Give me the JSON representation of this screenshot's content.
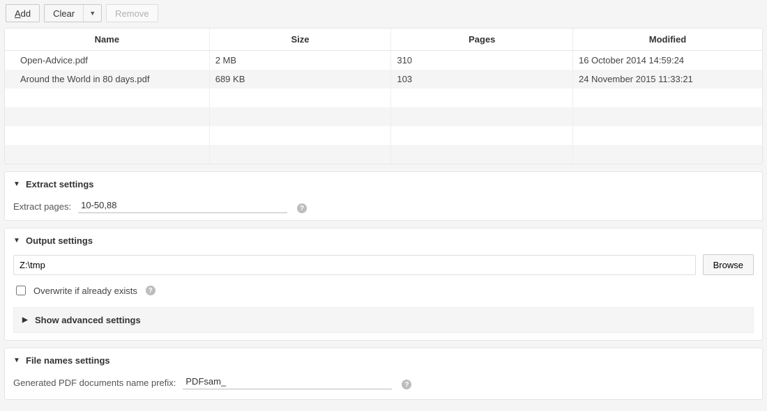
{
  "toolbar": {
    "add_label": "Add",
    "clear_label": "Clear",
    "remove_label": "Remove"
  },
  "table": {
    "columns": {
      "name": "Name",
      "size": "Size",
      "pages": "Pages",
      "modified": "Modified"
    },
    "rows": [
      {
        "name": "Open-Advice.pdf",
        "size": "2 MB",
        "pages": "310",
        "modified": "16 October 2014 14:59:24"
      },
      {
        "name": "Around the World in 80 days.pdf",
        "size": "689 KB",
        "pages": "103",
        "modified": "24 November 2015 11:33:21"
      }
    ]
  },
  "extract": {
    "title": "Extract settings",
    "pages_label": "Extract pages:",
    "pages_value": "10-50,88"
  },
  "output": {
    "title": "Output settings",
    "path": "Z:\\tmp",
    "browse_label": "Browse",
    "overwrite_label": "Overwrite if already exists",
    "advanced_label": "Show advanced settings"
  },
  "filenames": {
    "title": "File names settings",
    "prefix_label": "Generated PDF documents name prefix:",
    "prefix_value": "PDFsam_"
  }
}
